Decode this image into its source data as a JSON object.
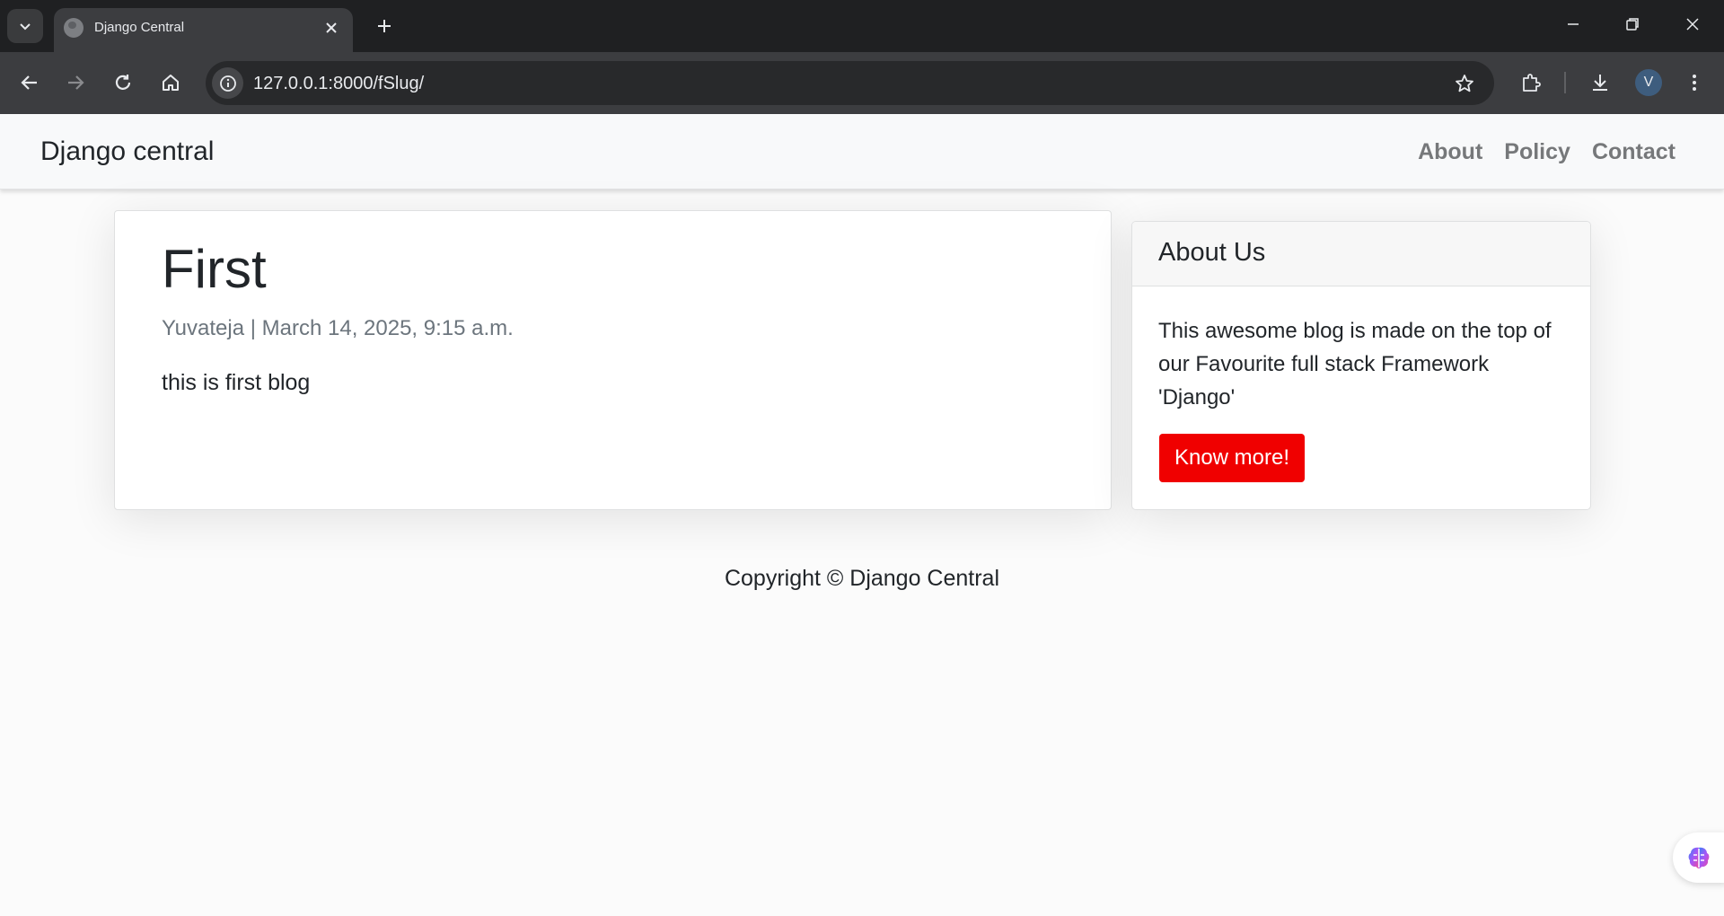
{
  "browser": {
    "tab_title": "Django Central",
    "url": "127.0.0.1:8000/fSlug/",
    "profile_initial": "V"
  },
  "navbar": {
    "brand": "Django central",
    "links": [
      "About",
      "Policy",
      "Contact"
    ]
  },
  "post": {
    "title": "First",
    "meta": "Yuvateja | March 14, 2025, 9:15 a.m.",
    "body": "this is first blog"
  },
  "sidebar": {
    "header": "About Us",
    "text": "This awesome blog is made on the top of our Favourite full stack Framework 'Django'",
    "button_label": "Know more!"
  },
  "footer": {
    "text": "Copyright © Django Central"
  },
  "colors": {
    "button_bg": "#f00000",
    "meta_text": "#6c757d",
    "nav_link": "#76787a"
  }
}
